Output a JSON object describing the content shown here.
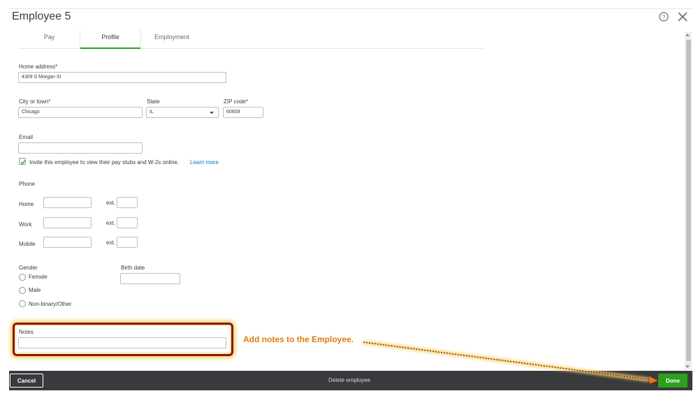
{
  "dialog": {
    "title": "Employee 5"
  },
  "tabs": [
    {
      "label": "Pay"
    },
    {
      "label": "Profile"
    },
    {
      "label": "Employment"
    }
  ],
  "form": {
    "home_address": {
      "label": "Home address*",
      "value": "4309 S Morgan St"
    },
    "city": {
      "label": "City or town*",
      "value": "Chicago"
    },
    "state": {
      "label": "State",
      "value": "IL"
    },
    "zip": {
      "label": "ZIP code*",
      "value": "60609"
    },
    "email": {
      "label": "Email",
      "value": ""
    },
    "invite": {
      "label": "Invite this employee to view their pay stubs and W-2s online.",
      "link": "Learn more",
      "checked": true
    },
    "phone": {
      "section_label": "Phone",
      "ext_label": "ext.",
      "rows": [
        {
          "label": "Home"
        },
        {
          "label": "Work"
        },
        {
          "label": "Mobile"
        }
      ]
    },
    "gender": {
      "label": "Gender",
      "options": [
        "Female",
        "Male",
        "Non-binary/Other"
      ]
    },
    "birth_date": {
      "label": "Birth date",
      "value": ""
    },
    "notes": {
      "label": "Notes",
      "value": ""
    }
  },
  "annotation": {
    "text": "Add notes to the Employee."
  },
  "footer": {
    "cancel_label": "Cancel",
    "delete_label": "Delete employee",
    "done_label": "Done"
  },
  "colors": {
    "accent": "#2ca01c",
    "footer_bg": "#393a3d",
    "link": "#0077c5",
    "annotation": "#e07a12",
    "highlight_border": "#8b1414",
    "highlight_glow": "#f3d36b"
  },
  "icons": {
    "help": "help-icon",
    "close": "close-icon",
    "check": "check-icon",
    "caret": "chevron-down-icon"
  }
}
